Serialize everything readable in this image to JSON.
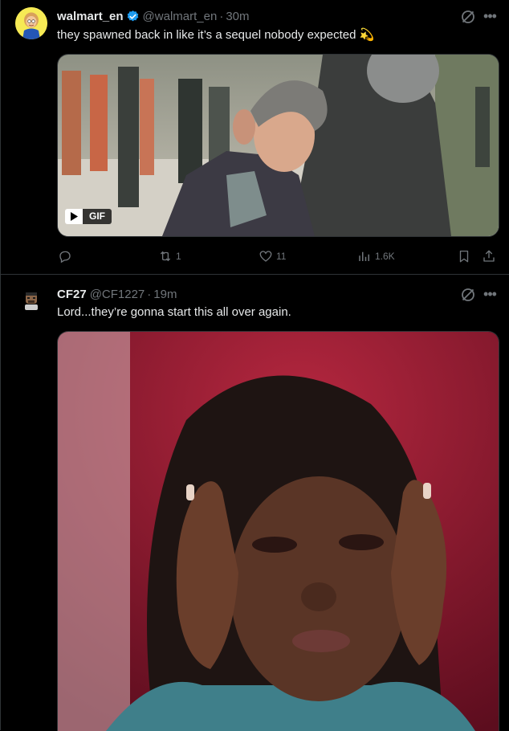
{
  "tweets": [
    {
      "display_name": "walmart_en",
      "handle": "@walmart_en",
      "separator": "·",
      "time": "30m",
      "text": "they spawned back in like it’s a sequel nobody expected 💫",
      "media_badge": "GIF",
      "actions": {
        "reply_count": "",
        "retweet_count": "1",
        "like_count": "11",
        "views_count": "1.6K"
      },
      "icons": [
        "grok-icon",
        "more-icon",
        "reply-icon",
        "retweet-icon",
        "like-icon",
        "views-icon",
        "bookmark-icon",
        "share-icon",
        "play-icon"
      ]
    },
    {
      "display_name": "CF27",
      "handle": "@CF1227",
      "separator": "·",
      "time": "19m",
      "text": "Lord...they’re gonna start this all over again.",
      "icons": [
        "grok-icon",
        "more-icon"
      ]
    }
  ],
  "colors": {
    "background": "#000000",
    "primary_text": "#e7e9ea",
    "secondary_text": "#71767b",
    "divider": "#2f3336",
    "verified_blue": "#1d9bf0"
  }
}
